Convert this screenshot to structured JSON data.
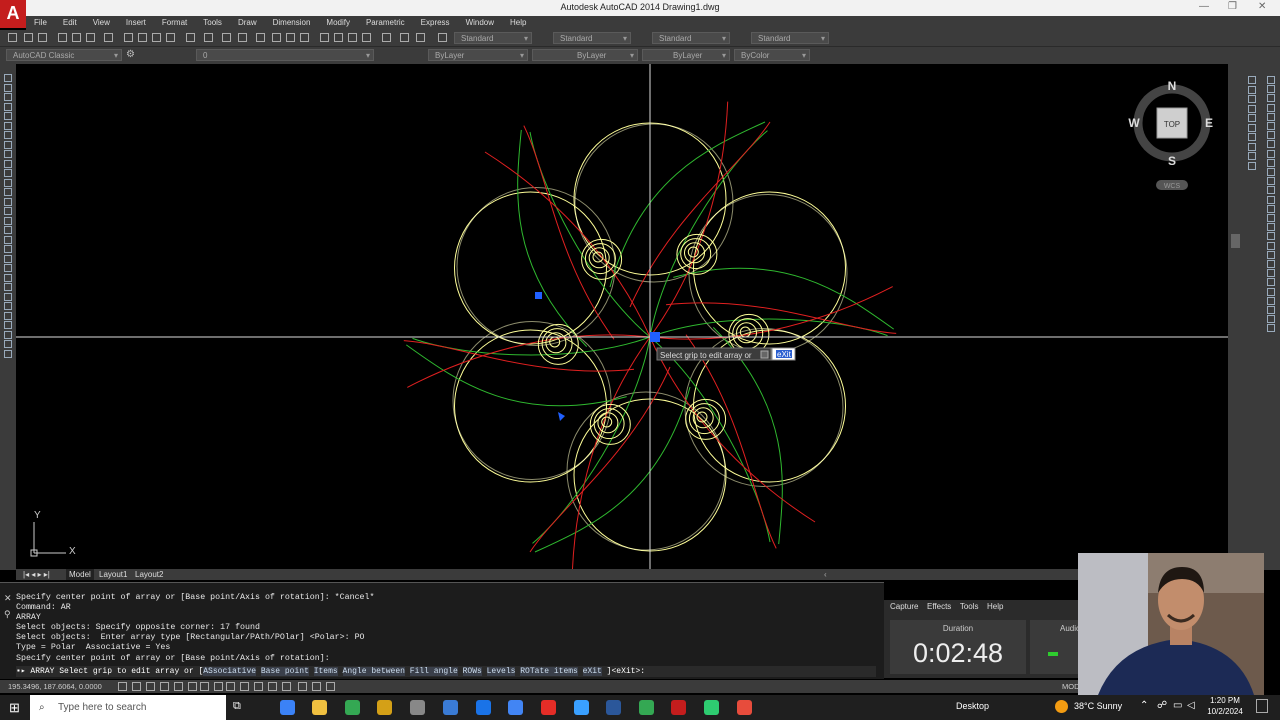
{
  "window": {
    "title": "Autodesk AutoCAD 2014   Drawing1.dwg",
    "app_logo": "A"
  },
  "menu": [
    "File",
    "Edit",
    "View",
    "Insert",
    "Format",
    "Tools",
    "Draw",
    "Dimension",
    "Modify",
    "Parametric",
    "Express",
    "Window",
    "Help"
  ],
  "toolbar": {
    "text_style": "Standard",
    "dim_style": "Standard",
    "table_style": "Standard",
    "mleader_style": "Standard",
    "workspace": "AutoCAD Classic",
    "layer": "0",
    "color": "ByLayer",
    "linetype": "ByLayer",
    "lineweight": "ByLayer",
    "plotstyle": "ByColor"
  },
  "viewcube": {
    "n": "N",
    "s": "S",
    "e": "E",
    "w": "W",
    "face": "TOP",
    "ucs": "WCS"
  },
  "ucs_icon": {
    "y": "Y",
    "x": "X"
  },
  "tooltip": {
    "text": "Select grip to edit array or",
    "input": "eXit"
  },
  "tabs": [
    "Model",
    "Layout1",
    "Layout2"
  ],
  "command_history": [
    "Specify center point of array or [Base point/Axis of rotation]: *Cancel*",
    "Command: AR",
    "ARRAY",
    "Select objects: Specify opposite corner: 17 found",
    "Select objects:  Enter array type [Rectangular/PAth/POlar] <Polar>: PO",
    "Type = Polar  Associative = Yes",
    "Specify center point of array or [Base point/Axis of rotation]:"
  ],
  "command_line": {
    "prefix": "ARRAY Select grip to edit array or [",
    "options": [
      "ASsociative",
      "Base point",
      "Items",
      "Angle between",
      "Fill angle",
      "ROWs",
      "Levels",
      "ROTate items",
      "eXit"
    ],
    "suffix": "]<eXit>:"
  },
  "status": {
    "coords": "195.3496, 187.6064, 0.0000",
    "model": "MODE"
  },
  "timer": {
    "menu": [
      "Capture",
      "Effects",
      "Tools",
      "Help"
    ],
    "duration_label": "Duration",
    "time": "0:02:48",
    "audio_label": "Audio"
  },
  "taskbar": {
    "search_placeholder": "Type here to search",
    "desktop": "Desktop",
    "weather": "38°C  Sunny",
    "time": "1:20 PM",
    "date": "10/2/2024"
  },
  "colors": {
    "circle": "#ffff99",
    "curve_red": "#e02020",
    "curve_green": "#2fb82f",
    "crosshair": "#ffffff",
    "grip": "#2060ff"
  }
}
